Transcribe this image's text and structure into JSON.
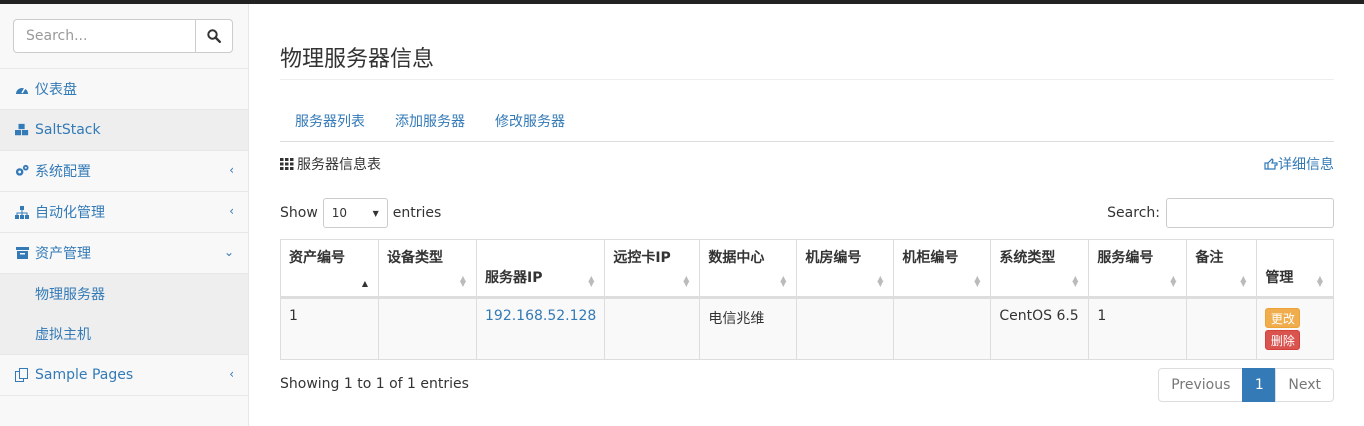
{
  "sidebar": {
    "search_placeholder": "Search...",
    "items": [
      {
        "label": "仪表盘",
        "icon": "dashboard-icon"
      },
      {
        "label": "SaltStack",
        "icon": "cubes-icon"
      },
      {
        "label": "系统配置",
        "icon": "gears-icon"
      },
      {
        "label": "自动化管理",
        "icon": "sitemap-icon"
      },
      {
        "label": "资产管理",
        "icon": "inbox-icon"
      },
      {
        "label": "Sample Pages",
        "icon": "files-icon"
      }
    ],
    "subitems": [
      "物理服务器",
      "虚拟主机"
    ]
  },
  "page": {
    "title": "物理服务器信息",
    "tabs": [
      "服务器列表",
      "添加服务器",
      "修改服务器"
    ],
    "panel_title": "服务器信息表",
    "detail_link": "详细信息"
  },
  "table": {
    "show_label": "Show",
    "length_value": "10",
    "entries_label": "entries",
    "search_label": "Search:",
    "columns": [
      "资产编号",
      "设备类型",
      "服务器IP",
      "远控卡IP",
      "数据中心",
      "机房编号",
      "机柜编号",
      "系统类型",
      "服务编号",
      "备注",
      "管理"
    ],
    "rows": [
      {
        "asset_no": "1",
        "device_type": "",
        "server_ip": "192.168.52.128",
        "remote_ip": "",
        "datacenter": "电信兆维",
        "room": "",
        "cabinet": "",
        "os": "CentOS 6.5",
        "service_no": "1",
        "note": ""
      }
    ],
    "edit_label": "更改",
    "delete_label": "删除",
    "info": "Showing 1 to 1 of 1 entries"
  },
  "pagination": {
    "previous": "Previous",
    "current": "1",
    "next": "Next"
  },
  "colors": {
    "link": "#337ab7",
    "warning": "#f0ad4e",
    "danger": "#d9534f"
  }
}
